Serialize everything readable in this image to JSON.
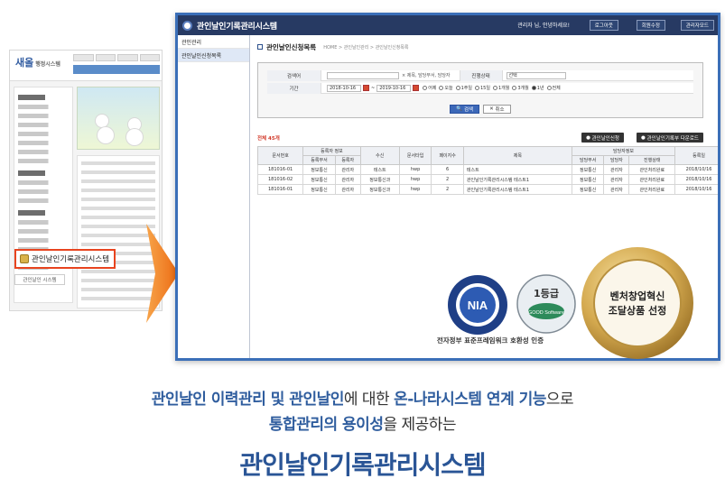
{
  "mini": {
    "logo": "새올",
    "logo_sub": "행정시스템",
    "callout_label": "관인날인기록관리시스템",
    "callout_button": "관인날인 시스템"
  },
  "window": {
    "title": "관인날인기록관리시스템",
    "user_greeting": "관리자 님, 안녕하세요!",
    "buttons": [
      "로그아웃",
      "회원수정",
      "관리자모드"
    ]
  },
  "sidebar": {
    "items": [
      "관인관리",
      "관인날인신청목록"
    ]
  },
  "page": {
    "title": "관인날인신청목록",
    "breadcrumb": "HOME > 관인날인관리 > 관인날인신청목록"
  },
  "search": {
    "keyword_label": "검색어",
    "keyword_hint": "× 제목, 담당부서, 담당자",
    "status_label": "진행상태",
    "status_value": "선택",
    "period_label": "기간",
    "date_from": "2018-10-16",
    "date_to": "2019-10-16",
    "periods": [
      "어제",
      "오늘",
      "1주일",
      "15일",
      "1개월",
      "3개월",
      "1년",
      "전체"
    ],
    "selected_period": "1년",
    "search_button": "검색",
    "cancel_button": "취소"
  },
  "table": {
    "count": "전체 45개",
    "new_button": "관인날인신청",
    "download_button": "관인날인기록부 다운로드",
    "group_headers": {
      "registrant": "등록자 정보",
      "manager": "담당자정보"
    },
    "headers": {
      "doc_no": "문서번호",
      "reg_dept": "등록부서",
      "reg_user": "등록자",
      "recipient": "수신",
      "doc_type": "문서타입",
      "pages": "페이지수",
      "title": "제목",
      "mgr_dept": "담당부서",
      "mgr_user": "담당자",
      "status": "진행상태",
      "reg_date": "등록일"
    },
    "rows": [
      {
        "doc_no": "181016-01",
        "reg_dept": "정보통신",
        "reg_user": "관리자",
        "recipient": "테스트",
        "doc_type": "hwp",
        "pages": "6",
        "title": "테스트",
        "mgr_dept": "정보통신",
        "mgr_user": "관리자",
        "status": "관인처리완료",
        "reg_date": "2018/10/16"
      },
      {
        "doc_no": "181016-02",
        "reg_dept": "정보통신",
        "reg_user": "관리자",
        "recipient": "정보통신과",
        "doc_type": "hwp",
        "pages": "2",
        "title": "관인날인기록관리시스템 테스트1",
        "mgr_dept": "정보통신",
        "mgr_user": "관리자",
        "status": "관인처리완료",
        "reg_date": "2018/10/16"
      },
      {
        "doc_no": "181016-01",
        "reg_dept": "정보통신",
        "reg_user": "관리자",
        "recipient": "정보통신과",
        "doc_type": "hwp",
        "pages": "2",
        "title": "관인날인기록관리시스템 테스트1",
        "mgr_dept": "정보통신",
        "mgr_user": "관리자",
        "status": "관인처리완료",
        "reg_date": "2018/10/16"
      }
    ]
  },
  "badges": {
    "nia_text": "NIA",
    "grade_text": "1등급",
    "grade_sub": "GOOD Software",
    "seal_line1": "벤처창업혁신",
    "seal_line2": "조달상품 선정",
    "cert_caption": "전자정부 표준프레임워크 호환성 인증"
  },
  "colors": {
    "title_blue": "#2a5596",
    "window_header": "#273a63",
    "callout_border": "#e8441f",
    "arrow_orange": "#f07a1a",
    "gold": "#c9a24a"
  },
  "bottom": {
    "line1_bold1": "관인날인 이력관리 및 관인날인",
    "line1_normal1": "에 대한 ",
    "line1_bold2": "온-나라시스템 연계 기능",
    "line1_normal2": "으로",
    "line2_bold": "통합관리의 용이성",
    "line2_normal": "을 제공하는",
    "title": "관인날인기록관리시스템"
  }
}
